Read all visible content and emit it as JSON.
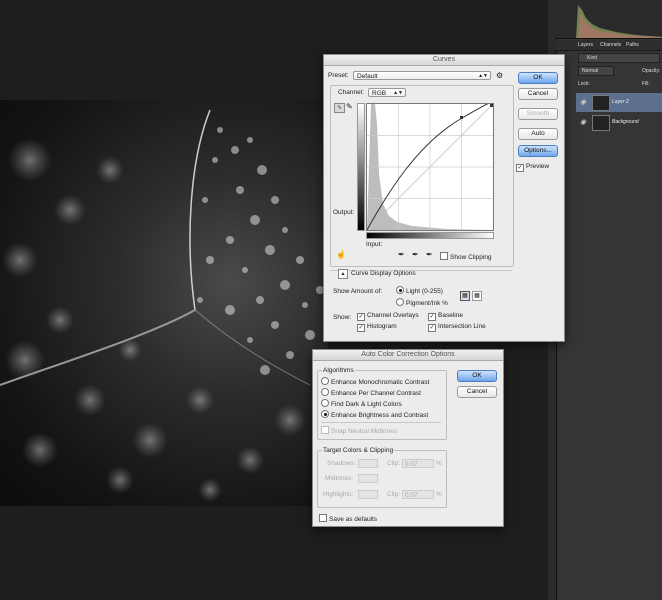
{
  "panel": {
    "tabs": [
      "Layers",
      "Channels",
      "Paths"
    ],
    "kind_label": "Kind",
    "blend_mode": "Normal",
    "opacity_label": "Opacity:",
    "lock_label": "Lock:",
    "fill_label": "Fill:",
    "layers": [
      "Layer 2",
      "Background"
    ]
  },
  "curves": {
    "title": "Curves",
    "preset_label": "Preset:",
    "preset_value": "Default",
    "channel_label": "Channel:",
    "channel_value": "RGB",
    "ok": "OK",
    "cancel": "Cancel",
    "smooth": "Smooth",
    "auto": "Auto",
    "options": "Options...",
    "preview": "Preview",
    "output_label": "Output:",
    "input_label": "Input:",
    "show_clipping": "Show Clipping",
    "display_options": "Curve Display Options",
    "show_amount_label": "Show Amount of:",
    "light_option": "Light  (0-255)",
    "pigment_option": "Pigment/Ink %",
    "show_label": "Show:",
    "channel_overlays": "Channel Overlays",
    "baseline": "Baseline",
    "histogram": "Histogram",
    "intersection_line": "Intersection Line"
  },
  "auto_color": {
    "title": "Auto Color Correction Options",
    "algorithms_label": "Algorithms",
    "algorithms": [
      "Enhance Monochromatic Contrast",
      "Enhance Per Channel Contrast",
      "Find Dark & Light Colors",
      "Enhance Brightness and Contrast"
    ],
    "selected_algorithm": "Enhance Brightness and Contrast",
    "snap_neutral": "Snap Neutral Midtones",
    "target_label": "Target Colors & Clipping",
    "shadows": "Shadows:",
    "midtones": "Midtones:",
    "highlights": "Highlights:",
    "clip_label": "Clip:",
    "clip_shadows": "0.07",
    "clip_highlights": "0.07",
    "percent": "%",
    "save_defaults": "Save as defaults",
    "ok": "OK",
    "cancel": "Cancel"
  },
  "icons": [
    "gear-icon",
    "curve-point-tool-icon",
    "pencil-icon",
    "eyedropper-icon",
    "hand-adjust-icon",
    "eye-icon",
    "grid-icon",
    "collapse-icon"
  ],
  "colors": {
    "accent": "#6ea6ea",
    "dialog_bg": "#ececec",
    "app_bg": "#1e1e1e"
  }
}
